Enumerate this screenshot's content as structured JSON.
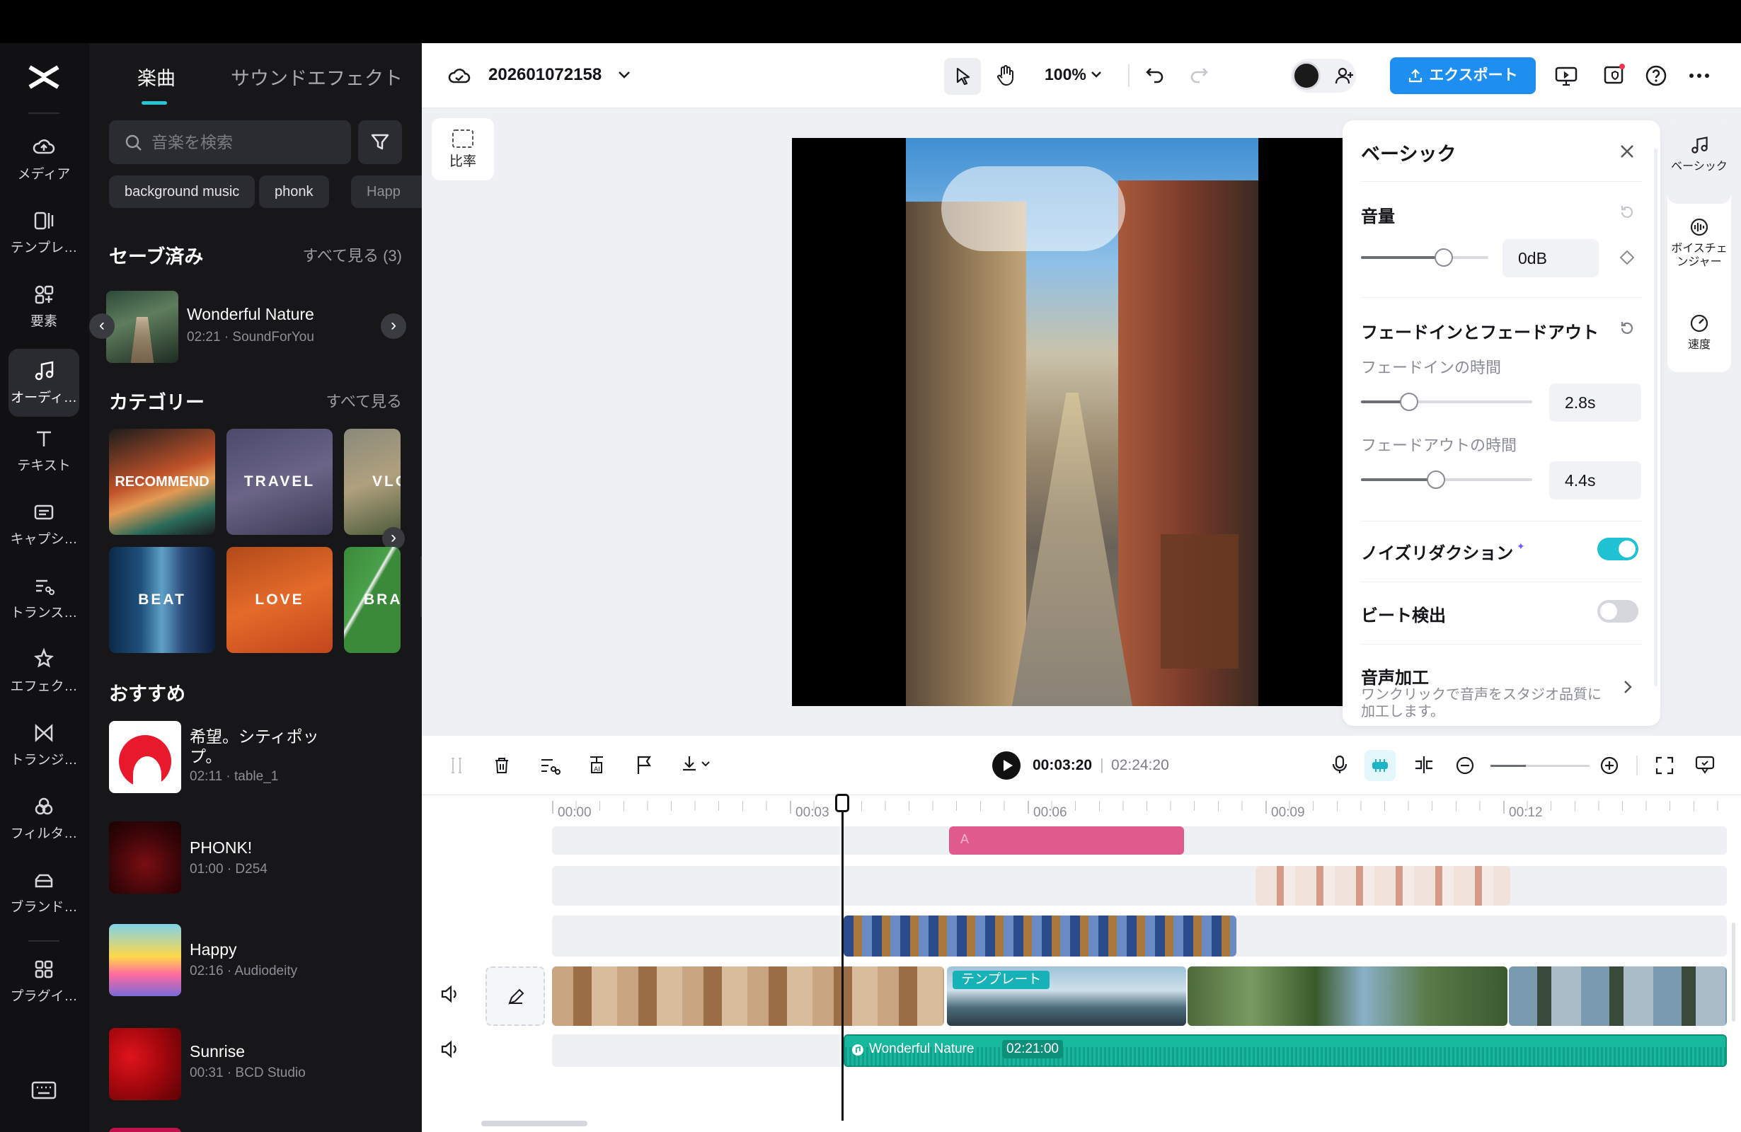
{
  "app": {
    "name": "CapCut"
  },
  "colors": {
    "accent": "#27c4d4",
    "export": "#1f8ef1",
    "pink_clip": "#e05a8e",
    "audio_clip": "#17b89d"
  },
  "nav": {
    "items": [
      {
        "label": "メディア",
        "icon": "cloud-icon"
      },
      {
        "label": "テンプレ…",
        "icon": "template-icon"
      },
      {
        "label": "要素",
        "icon": "elements-icon"
      },
      {
        "label": "オーディ…",
        "icon": "music-note-icon",
        "active": true
      },
      {
        "label": "テキスト",
        "icon": "text-icon"
      },
      {
        "label": "キャプシ…",
        "icon": "caption-icon"
      },
      {
        "label": "トランス…",
        "icon": "transcript-icon"
      },
      {
        "label": "エフェク…",
        "icon": "effects-icon"
      },
      {
        "label": "トランジ…",
        "icon": "transition-icon"
      },
      {
        "label": "フィルタ…",
        "icon": "filter-icon"
      },
      {
        "label": "ブランド…",
        "icon": "brand-icon"
      },
      {
        "label": "プラグイ…",
        "icon": "plugin-icon"
      }
    ]
  },
  "audio_panel": {
    "tabs": [
      "楽曲",
      "サウンドエフェクト"
    ],
    "search_placeholder": "音楽を検索",
    "chips": [
      "background music",
      "phonk",
      "Happ"
    ],
    "saved": {
      "title": "セーブ済み",
      "link": "すべて見る (3)",
      "track": {
        "title": "Wonderful Nature",
        "sub": "02:21 · SoundForYou"
      }
    },
    "categories": {
      "title": "カテゴリー",
      "link": "すべて見る",
      "items": [
        "RECOMMEND",
        "TRAVEL",
        "VLO",
        "BEAT",
        "LOVE",
        "BRA"
      ]
    },
    "recommended": {
      "title": "おすすめ",
      "tracks": [
        {
          "title": "希望。シティポップ。",
          "sub": "02:11 · table_1"
        },
        {
          "title": "PHONK!",
          "sub": "01:00 · D254"
        },
        {
          "title": "Happy",
          "sub": "02:16 · Audiodeity"
        },
        {
          "title": "Sunrise",
          "sub": "00:31 · BCD Studio"
        }
      ]
    }
  },
  "topbar": {
    "project": "202601072158",
    "zoom": "100%",
    "export": "エクスポート"
  },
  "stage": {
    "ratio_label": "比率"
  },
  "basic_panel": {
    "title": "ベーシック",
    "volume": {
      "label": "音量",
      "value": "0dB",
      "level": 0.65
    },
    "fade": {
      "label": "フェードインとフェードアウト",
      "fade_in_label": "フェードインの時間",
      "fade_in_value": "2.8s",
      "fade_in_level": 0.28,
      "fade_out_label": "フェードアウトの時間",
      "fade_out_value": "4.4s",
      "fade_out_level": 0.44
    },
    "noise_reduction": {
      "label": "ノイズリダクション",
      "on": true
    },
    "beat_detect": {
      "label": "ビート検出",
      "on": false
    },
    "voice_enhance": {
      "label": "音声加工",
      "desc": "ワンクリックで音声をスタジオ品質に加工します。"
    }
  },
  "side_tabs": [
    {
      "label": "ベーシック",
      "icon": "music-note-icon"
    },
    {
      "label": "ボイスチェンジャー",
      "icon": "voice-changer-icon"
    },
    {
      "label": "速度",
      "icon": "speed-icon"
    }
  ],
  "timeline": {
    "current_time": "00:03:20",
    "total_time": "02:24:20",
    "ruler": [
      "00:00",
      "00:03",
      "00:06",
      "00:09",
      "00:12"
    ],
    "template_label": "テンプレート",
    "audio_clip": {
      "title": "Wonderful Nature",
      "duration": "02:21:00"
    }
  }
}
